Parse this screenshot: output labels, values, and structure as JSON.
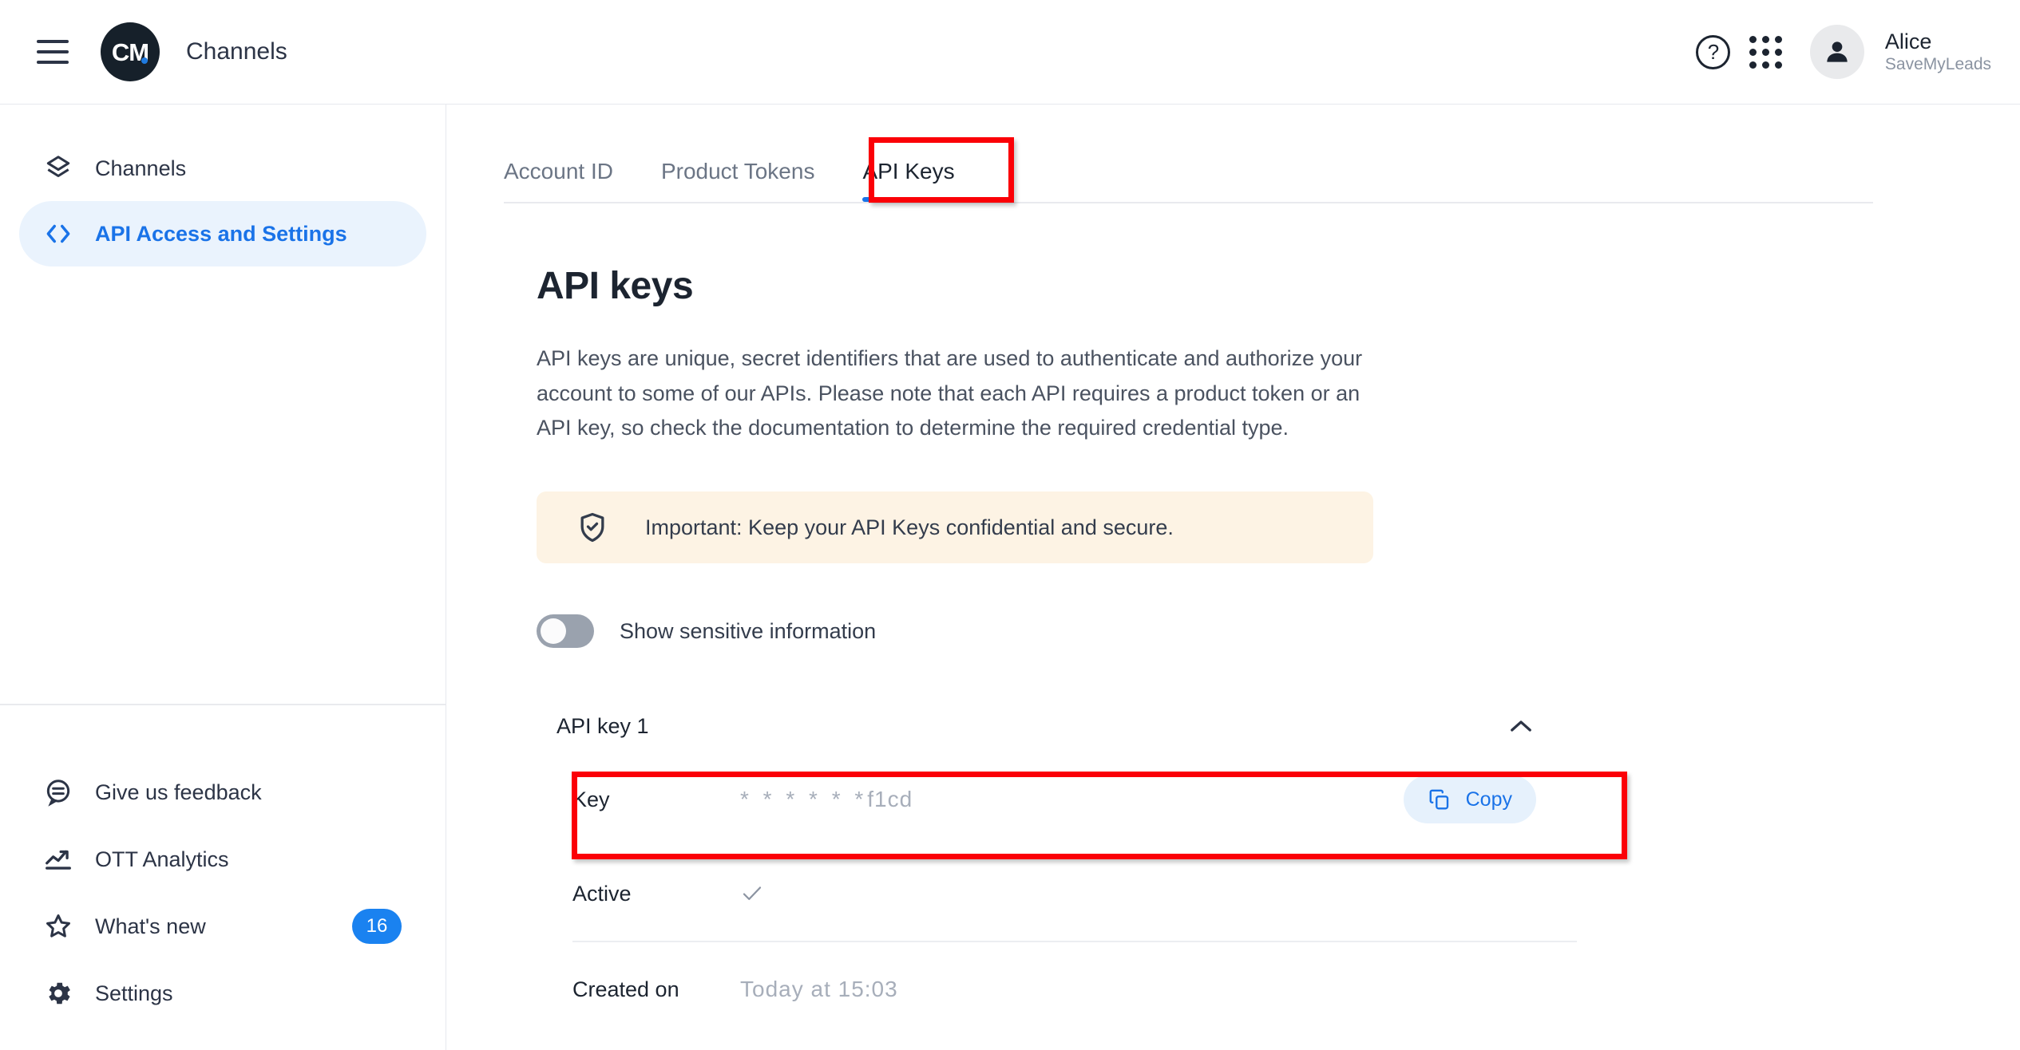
{
  "topbar": {
    "menu_icon": "hamburger-icon",
    "logo_text": "CM",
    "app_title": "Channels",
    "help_icon": "question-mark-icon",
    "apps_icon": "grid-apps-icon",
    "avatar_icon": "person-icon",
    "user_name": "Alice",
    "user_org": "SaveMyLeads"
  },
  "sidebar": {
    "items": [
      {
        "label": "Channels",
        "icon": "layers-icon",
        "active": false
      },
      {
        "label": "API Access and Settings",
        "icon": "code-brackets-icon",
        "active": true
      }
    ],
    "bottom_items": [
      {
        "label": "Give us feedback",
        "icon": "feedback-chat-icon",
        "badge": ""
      },
      {
        "label": "OTT Analytics",
        "icon": "trending-up-icon",
        "badge": ""
      },
      {
        "label": "What's new",
        "icon": "star-icon",
        "badge": "16"
      },
      {
        "label": "Settings",
        "icon": "gear-icon",
        "badge": ""
      }
    ]
  },
  "main": {
    "tabs": [
      {
        "label": "Account ID",
        "active": false
      },
      {
        "label": "Product Tokens",
        "active": false
      },
      {
        "label": "API Keys",
        "active": true
      }
    ],
    "page_title": "API keys",
    "page_description": "API keys are unique, secret identifiers that are used to authenticate and authorize your account to some of our APIs. Please note that each API requires a product token or an API key, so check the documentation to determine the required credential type.",
    "notice": {
      "icon": "shield-check-icon",
      "text": "Important: Keep your API Keys confidential and secure."
    },
    "toggle": {
      "label": "Show sensitive information",
      "state": "off"
    },
    "accordion": {
      "title": "API key 1",
      "chevron_icon": "chevron-up-icon",
      "rows": [
        {
          "label": "Key",
          "value": "✱✱✱✱✱✱f1cd",
          "stars": "* * * * * *",
          "tail": "f1cd"
        },
        {
          "label": "Active",
          "value": "✓"
        },
        {
          "label": "Created on",
          "value": "Today at 15:03"
        }
      ],
      "copy_button": {
        "label": "Copy",
        "icon": "copy-icon"
      }
    }
  },
  "annotations": {
    "color": "#fb0007",
    "boxes": [
      "api-keys-tab",
      "key-row"
    ]
  }
}
